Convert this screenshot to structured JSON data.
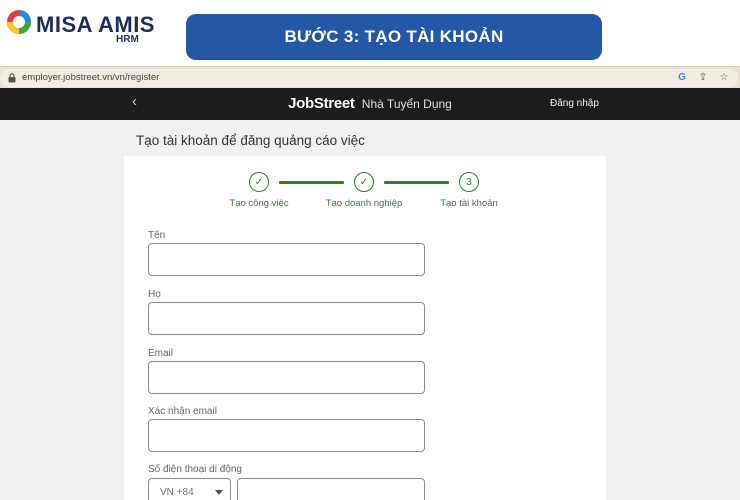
{
  "banner": {
    "brand_name": "MISA AMIS",
    "brand_sub": "HRM",
    "step_title": "BƯỚC 3: TẠO TÀI KHOẢN"
  },
  "browser": {
    "url": "employer.jobstreet.vn/vn/register",
    "icons": [
      "lock-icon",
      "google-icon",
      "share-icon",
      "star-icon"
    ]
  },
  "nav": {
    "back_icon": "‹",
    "brand_main": "JobStreet",
    "brand_sub": "Nhà Tuyển Dụng",
    "login": "Đăng nhập"
  },
  "page": {
    "title": "Tạo tài khoản để đăng quảng cáo việc"
  },
  "stepper": {
    "steps": [
      {
        "label": "Tạo công việc",
        "state": "done",
        "mark": "✓"
      },
      {
        "label": "Tạo doanh nghiệp",
        "state": "done",
        "mark": "✓"
      },
      {
        "label": "Tạo tài khoản",
        "state": "current",
        "mark": "3"
      }
    ],
    "color": "#2e7d32"
  },
  "form": {
    "first_name": {
      "label": "Tên",
      "value": ""
    },
    "last_name": {
      "label": "Họ",
      "value": ""
    },
    "email": {
      "label": "Email",
      "value": ""
    },
    "email_confirm": {
      "label": "Xác nhận email",
      "value": ""
    },
    "phone": {
      "label": "Số điện thoại di động",
      "country_code": "VN +84",
      "value": ""
    }
  },
  "colors": {
    "banner_pill": "#2458a6",
    "nav_bg": "#1c1c1c",
    "accent_green": "#2e7d32"
  }
}
